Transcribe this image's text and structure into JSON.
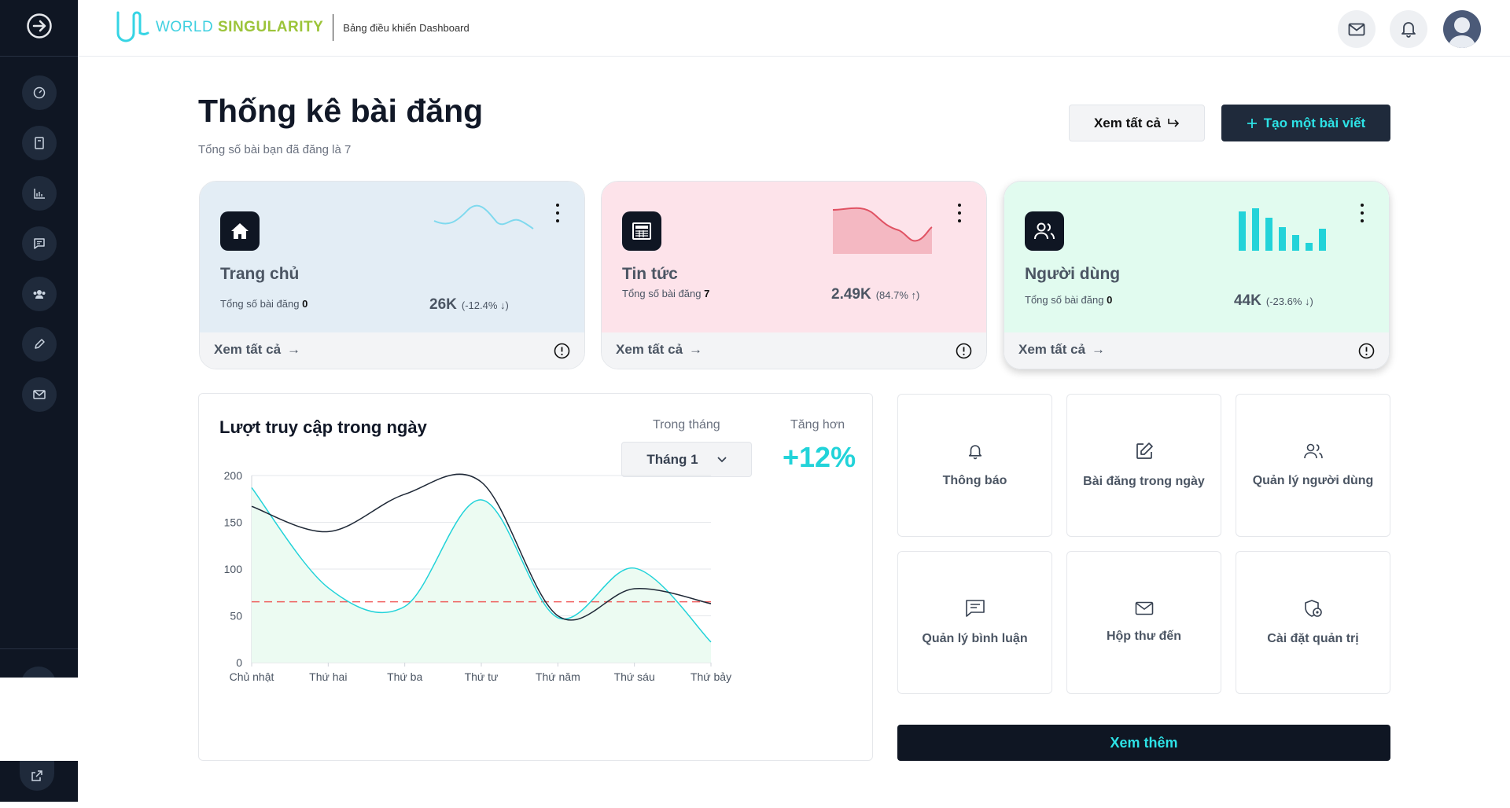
{
  "header": {
    "logo_word1": "WORLD ",
    "logo_word2": "SINGULARITY",
    "subtitle": "Bảng điều khiển Dashboard"
  },
  "page": {
    "title": "Thống kê bài đăng",
    "subtitle": "Tổng số bài bạn đã đăng là 7",
    "view_all": "Xem tất cả",
    "create": "Tạo một bài viết"
  },
  "cards": [
    {
      "title": "Trang chủ",
      "sub_label": "Tổng số bài đăng ",
      "sub_count": "0",
      "stat": "26K",
      "change": "(-12.4% ↓)",
      "footer": "Xem tất cả",
      "bg": "#e3edf5",
      "spark_color": "#7fd9ee"
    },
    {
      "title": "Tin tức",
      "sub_label": "Tổng số bài đăng ",
      "sub_count": "7",
      "stat": "2.49K",
      "change": "(84.7% ↑)",
      "footer": "Xem tất cả",
      "bg": "#fde3ea",
      "spark_color": "#e05263"
    },
    {
      "title": "Người dùng",
      "sub_label": "Tổng số bài đăng ",
      "sub_count": "0",
      "stat": "44K",
      "change": "(-23.6% ↓)",
      "footer": "Xem tất cả",
      "bg": "#e1fbef",
      "spark_color": "#22d3d9"
    }
  ],
  "chart_panel": {
    "title": "Lượt truy cập trong ngày",
    "month_label": "Trong tháng",
    "month_value": "Tháng 1",
    "growth_label": "Tăng hơn",
    "growth_value": "+12%"
  },
  "chart_data": {
    "type": "line",
    "categories": [
      "Chủ nhật",
      "Thứ hai",
      "Thứ ba",
      "Thứ tư",
      "Thứ năm",
      "Thứ sáu",
      "Thứ bảy"
    ],
    "ylim": [
      0,
      200
    ],
    "yticks": [
      0,
      50,
      100,
      150,
      200
    ],
    "series": [
      {
        "values": [
          187,
          80,
          60,
          174,
          48,
          101,
          22
        ],
        "color": "#22d3d9",
        "fill": "#ecfbf2"
      },
      {
        "values": [
          167,
          140,
          180,
          193,
          50,
          79,
          63
        ],
        "color": "#1f2937"
      }
    ],
    "reference_line": {
      "value": 65,
      "color": "#ef4444"
    },
    "grid": true
  },
  "tiles": [
    {
      "label": "Thông báo",
      "icon": "bell-icon"
    },
    {
      "label": "Bài đăng trong ngày",
      "icon": "edit-icon"
    },
    {
      "label": "Quản lý người dùng",
      "icon": "users-icon"
    },
    {
      "label": "Quản lý bình luận",
      "icon": "comment-icon"
    },
    {
      "label": "Hộp thư đến",
      "icon": "mail-icon"
    },
    {
      "label": "Cài đặt quản trị",
      "icon": "shield-settings-icon"
    }
  ],
  "more_button": "Xem thêm",
  "colors": {
    "accent": "#22d3d9",
    "dark": "#0f1623"
  }
}
